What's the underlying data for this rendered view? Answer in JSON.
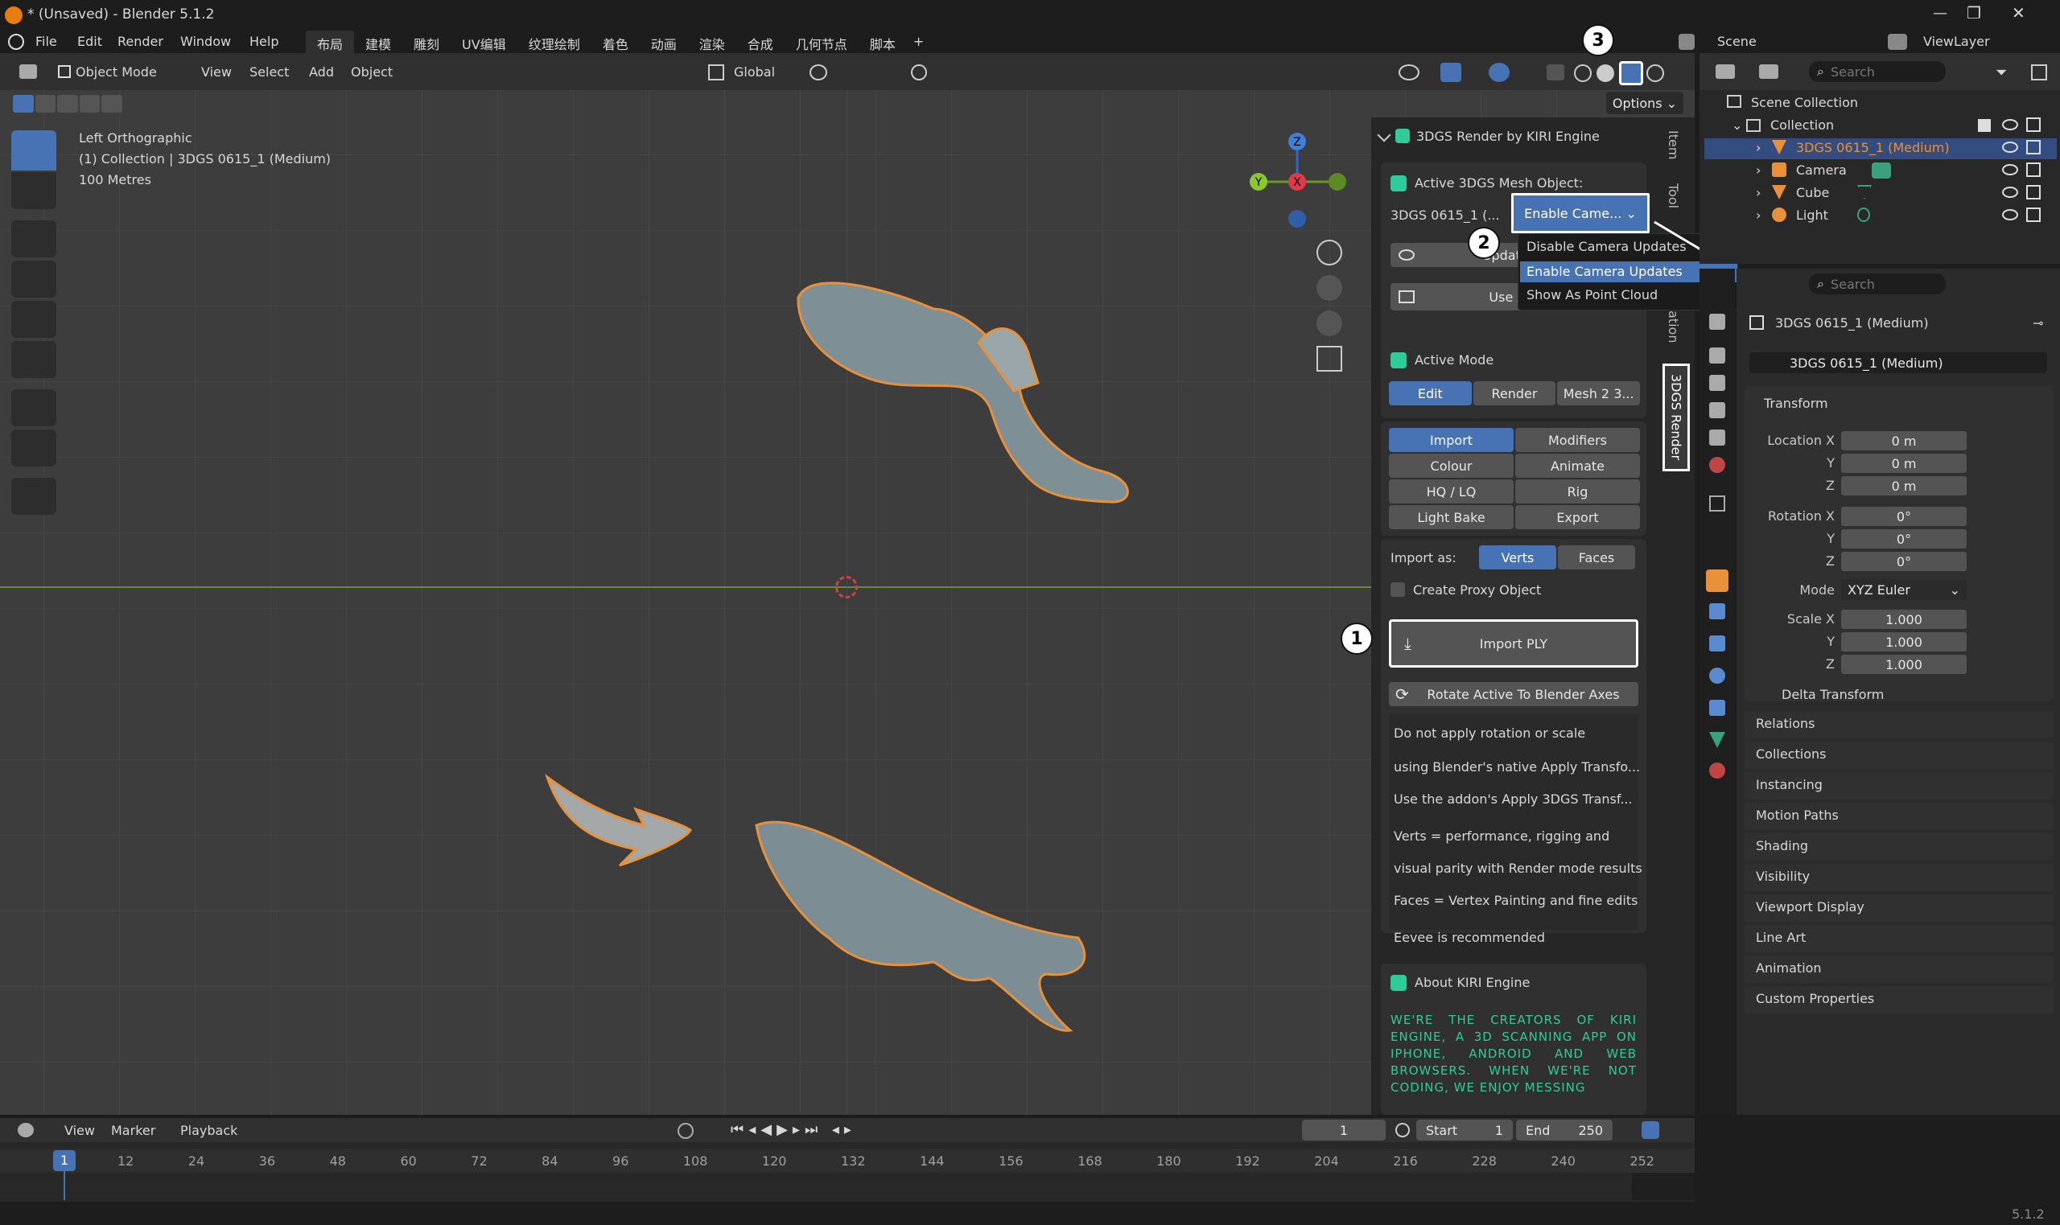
{
  "window": {
    "title": "* (Unsaved) - Blender 5.1.2"
  },
  "menu": {
    "file": "File",
    "edit": "Edit",
    "render": "Render",
    "window": "Window",
    "help": "Help"
  },
  "workspaces": [
    "布局",
    "建模",
    "雕刻",
    "UV编辑",
    "纹理绘制",
    "着色",
    "动画",
    "渲染",
    "合成",
    "几何节点",
    "脚本",
    "+"
  ],
  "topbar_right": {
    "scene": "Scene",
    "view_layer": "ViewLayer"
  },
  "viewport_header": {
    "mode": "Object Mode",
    "view": "View",
    "select": "Select",
    "add": "Add",
    "object": "Object",
    "orientation": "Global",
    "options": "Options"
  },
  "viewport_info": {
    "line1": "Left Orthographic",
    "line2": "(1) Collection | 3DGS 0615_1 (Medium)",
    "line3": "100 Metres"
  },
  "gizmo": {
    "z": "Z",
    "y": "Y",
    "x": "X"
  },
  "sidebar_tabs": {
    "item": "Item",
    "tool": "Tool",
    "ation": "ation",
    "render3dgs": "3DGS Render"
  },
  "kiri": {
    "title": "3DGS Render by KIRI Engine",
    "active_label": "Active 3DGS Mesh Object:",
    "active_value": "3DGS 0615_1 (...",
    "enable_dropdown": "Enable Came...",
    "update_btn": "Update Ac",
    "use_active_btn": "Use Acti",
    "dropdown_items": [
      "Disable Camera Updates",
      "Enable Camera Updates",
      "Show As Point Cloud"
    ],
    "active_mode_label": "Active Mode",
    "mode_tabs": [
      "Edit",
      "Render",
      "Mesh 2 3..."
    ],
    "sub_tabs": [
      "Import",
      "Modifiers",
      "Colour",
      "Animate",
      "HQ / LQ",
      "Rig",
      "Light Bake",
      "Export"
    ],
    "import_as": "Import as:",
    "verts": "Verts",
    "faces": "Faces",
    "create_proxy": "Create Proxy Object",
    "import_ply": "Import PLY",
    "rotate_btn": "Rotate Active To Blender Axes",
    "notes": [
      "Do not apply rotation or scale",
      "using Blender's native Apply Transfo...",
      "Use the addon's Apply 3DGS Transf...",
      "Verts = performance, rigging and",
      "visual parity with Render mode results",
      "Faces = Vertex Painting and fine edits",
      "Eevee is recommended"
    ],
    "about_label": "About KIRI Engine",
    "about_text": "WE'RE THE CREATORS OF KIRI ENGINE, A 3D SCANNING APP ON IPHONE, ANDROID AND WEB BROWSERS. WHEN WE'RE NOT CODING, WE ENJOY MESSING"
  },
  "callouts": [
    "1",
    "2",
    "3"
  ],
  "outliner": {
    "search": "Search",
    "scene_collection": "Scene Collection",
    "collection": "Collection",
    "items": [
      "3DGS 0615_1 (Medium)",
      "Camera",
      "Cube",
      "Light"
    ]
  },
  "properties": {
    "search": "Search",
    "object_name": "3DGS 0615_1 (Medium)",
    "datablock": "3DGS 0615_1 (Medium)",
    "transform": "Transform",
    "location_x": "Location X",
    "location_y": "Y",
    "location_z": "Z",
    "loc_vals": [
      "0 m",
      "0 m",
      "0 m"
    ],
    "rotation_x": "Rotation X",
    "rotation_y": "Y",
    "rotation_z": "Z",
    "rot_vals": [
      "0°",
      "0°",
      "0°"
    ],
    "mode_label": "Mode",
    "mode_value": "XYZ Euler",
    "scale_x": "Scale X",
    "scale_y": "Y",
    "scale_z": "Z",
    "scale_vals": [
      "1.000",
      "1.000",
      "1.000"
    ],
    "delta": "Delta Transform",
    "sections": [
      "Relations",
      "Collections",
      "Instancing",
      "Motion Paths",
      "Shading",
      "Visibility",
      "Viewport Display",
      "Line Art",
      "Animation",
      "Custom Properties"
    ]
  },
  "timeline": {
    "view": "View",
    "marker": "Marker",
    "playback": "Playback",
    "frame": "1",
    "start_label": "Start",
    "start": "1",
    "end_label": "End",
    "end": "250",
    "current": "1",
    "ticks": [
      "12",
      "24",
      "36",
      "48",
      "60",
      "72",
      "84",
      "96",
      "108",
      "120",
      "132",
      "144",
      "156",
      "168",
      "180",
      "192",
      "204",
      "216",
      "228",
      "240",
      "252"
    ]
  },
  "version": "5.1.2",
  "colors": {
    "accent": "#4772b3",
    "orange": "#e8903a",
    "kiri_green": "#2ecc9a"
  }
}
